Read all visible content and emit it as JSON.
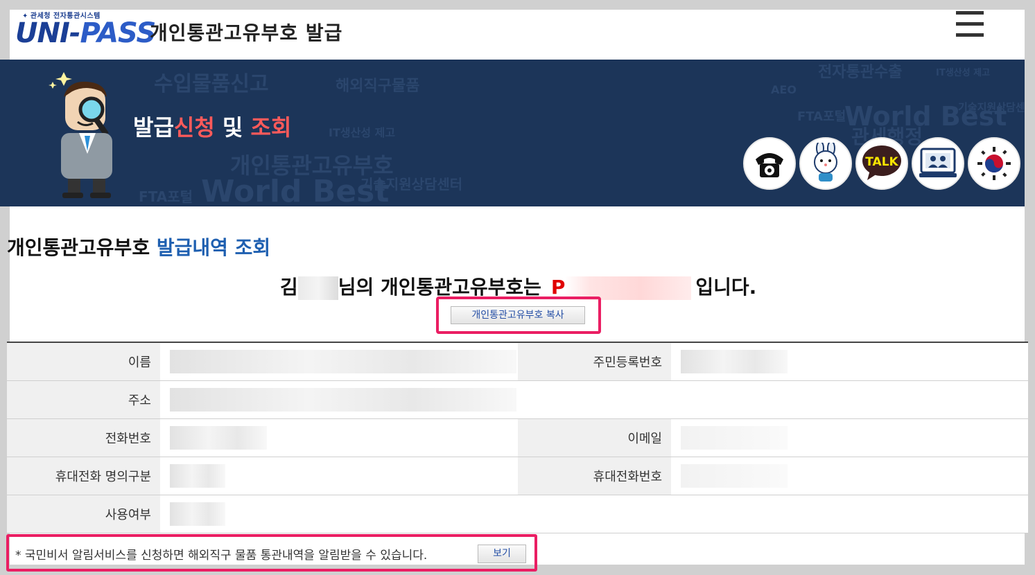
{
  "header": {
    "logo_top": "관세청 전자통관시스템",
    "logo_text_a": "UNI-",
    "logo_text_b": "PASS",
    "title": "개인통관고유부호 발급"
  },
  "banner": {
    "title_part1": "발급",
    "title_part2": "신청",
    "title_part3": " 및 ",
    "title_part4": "조회",
    "background_words": [
      "수입물품신고",
      "해외직구물품",
      "개인통관고유부호",
      "World Best",
      "기술지원상담센터",
      "FTA포털",
      "전자통관수출",
      "AEO",
      "관세행정",
      "IT생산성 제고"
    ],
    "talk_label": "TALK",
    "icons": [
      "phone-icon",
      "mascot-chat-icon",
      "kakaotalk-icon",
      "remote-support-icon",
      "government-emblem-icon"
    ]
  },
  "section": {
    "title_part1": "개인통관고유부호 ",
    "title_part2": "발급내역 조회"
  },
  "result": {
    "prefix": "김",
    "mid": "님의 개인통관고유부호는",
    "code_start": "P",
    "suffix": "입니다."
  },
  "copy_button": "개인통관고유부호 복사",
  "table": {
    "rows": [
      {
        "l1": "이름",
        "l2": "주민등록번호"
      },
      {
        "l1": "주소",
        "l2": ""
      },
      {
        "l1": "전화번호",
        "l2": "이메일"
      },
      {
        "l1": "휴대전화 명의구분",
        "l2": "휴대전화번호"
      },
      {
        "l1": "사용여부",
        "l2": ""
      }
    ]
  },
  "notice": {
    "text": "* 국민비서 알림서비스를 신청하면 해외직구 물품 통관내역을 알림받을 수 있습니다.",
    "button": "보기"
  },
  "colors": {
    "banner_bg": "#1c3559",
    "highlight": "#ea1e63",
    "accent_blue": "#1e5fb0",
    "code_red": "#e00000"
  }
}
